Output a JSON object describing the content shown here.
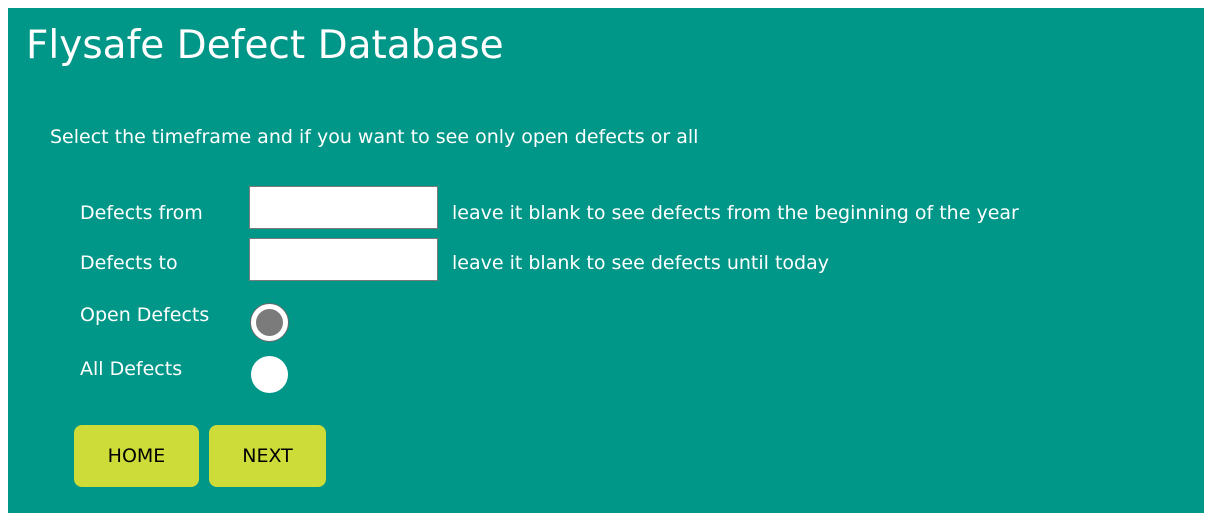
{
  "header": {
    "title": "Flysafe Defect Database"
  },
  "form": {
    "intro": "Select the timeframe and if you want to see only open defects or all",
    "from": {
      "label": "Defects from",
      "value": "",
      "hint": "leave it blank to see defects from the beginning of the year"
    },
    "to": {
      "label": "Defects to",
      "value": "",
      "hint": "leave it blank to see defects until today"
    },
    "filter": {
      "options": [
        {
          "label": "Open Defects",
          "selected": true
        },
        {
          "label": "All Defects",
          "selected": false
        }
      ]
    }
  },
  "buttons": {
    "home": "HOME",
    "next": "NEXT"
  },
  "colors": {
    "background": "#009688",
    "button": "#cddc39",
    "radio_selected": "#7b7b7b"
  }
}
